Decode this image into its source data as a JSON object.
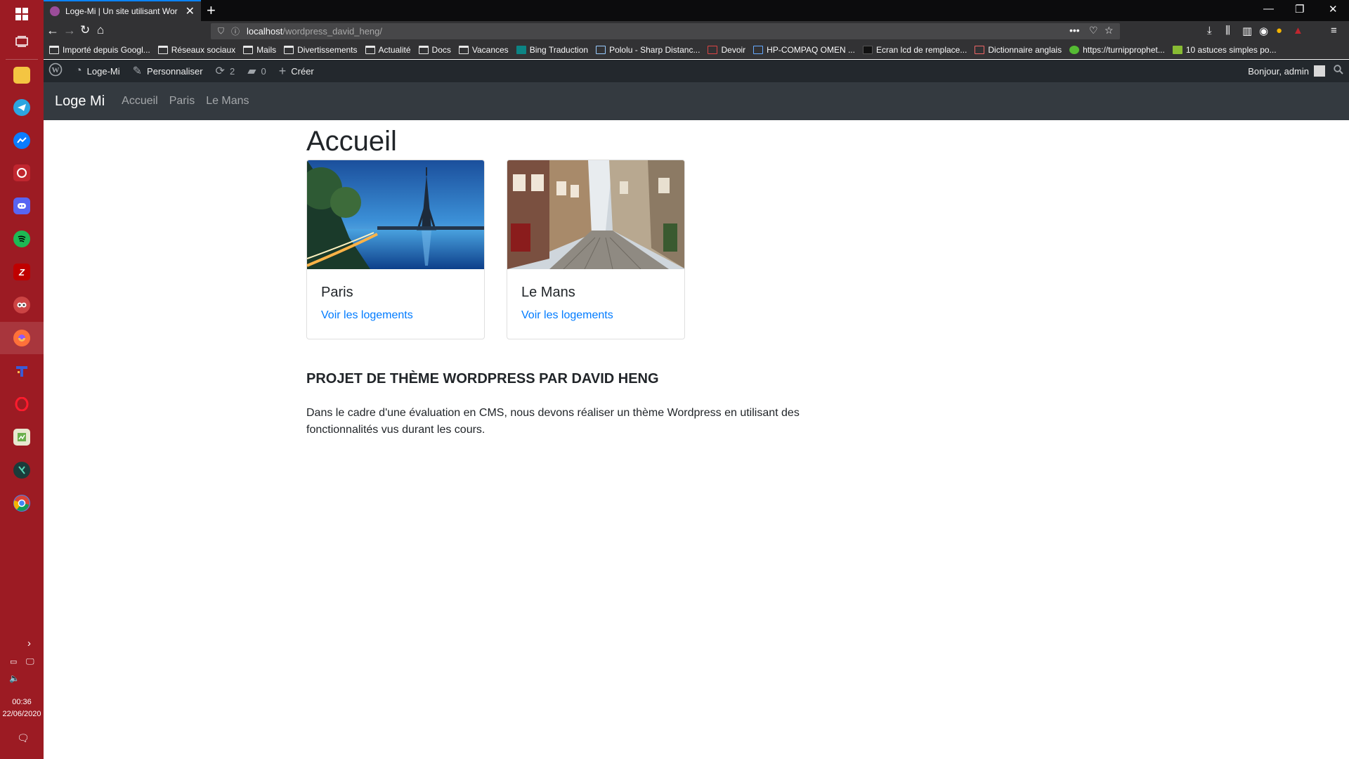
{
  "taskbar": {
    "apps": [
      {
        "name": "start",
        "color": "#9c1b23"
      },
      {
        "name": "task-view",
        "color": "#9c1b23"
      },
      {
        "name": "file-explorer",
        "color": "#f4c542"
      },
      {
        "name": "telegram",
        "color": "#2ca5e0"
      },
      {
        "name": "messenger",
        "color": "#0a7cff"
      },
      {
        "name": "whatsapp",
        "color": "#25d366"
      },
      {
        "name": "discord",
        "color": "#5865f2"
      },
      {
        "name": "spotify",
        "color": "#1db954"
      },
      {
        "name": "filezilla",
        "color": "#bf0000"
      },
      {
        "name": "owl-app",
        "color": "#c44"
      },
      {
        "name": "firefox",
        "color": "#ff7139"
      },
      {
        "name": "tool-app",
        "color": "#3a5bd6"
      },
      {
        "name": "opera",
        "color": "#ff1b2d"
      },
      {
        "name": "notepad-app",
        "color": "#6ab04c"
      },
      {
        "name": "kotlin-app",
        "color": "#1b6b5a"
      },
      {
        "name": "chrome",
        "color": "#4285f4"
      }
    ],
    "clock_time": "00:36",
    "clock_date": "22/06/2020"
  },
  "browser": {
    "tab_title": "Loge-Mi | Un site utilisant Wor",
    "url_host": "localhost",
    "url_path": "/wordpress_david_heng/",
    "bookmarks": [
      "Importé depuis Googl...",
      "Réseaux sociaux",
      "Mails",
      "Divertissements",
      "Actualité",
      "Docs",
      "Vacances",
      "Bing Traduction",
      "Pololu - Sharp Distanc...",
      "Devoir",
      "HP-COMPAQ OMEN ...",
      "Ecran lcd de remplace...",
      "Dictionnaire anglais",
      "https://turnipprophet...",
      "10 astuces simples po..."
    ]
  },
  "adminbar": {
    "site_name": "Loge-Mi",
    "customize": "Personnaliser",
    "updates_count": "2",
    "comments_count": "0",
    "create": "Créer",
    "greeting": "Bonjour, admin"
  },
  "site": {
    "brand": "Loge Mi",
    "nav": [
      "Accueil",
      "Paris",
      "Le Mans"
    ]
  },
  "main": {
    "title": "Accueil",
    "cards": [
      {
        "title": "Paris",
        "link": "Voir les logements"
      },
      {
        "title": "Le Mans",
        "link": "Voir les logements"
      }
    ],
    "subhead": "PROJET DE THÈME WORDPRESS PAR DAVID HENG",
    "description": "Dans le cadre d'une évaluation en CMS, nous devons réaliser un thème Wordpress en utilisant des fonctionnalités vus durant les cours."
  }
}
